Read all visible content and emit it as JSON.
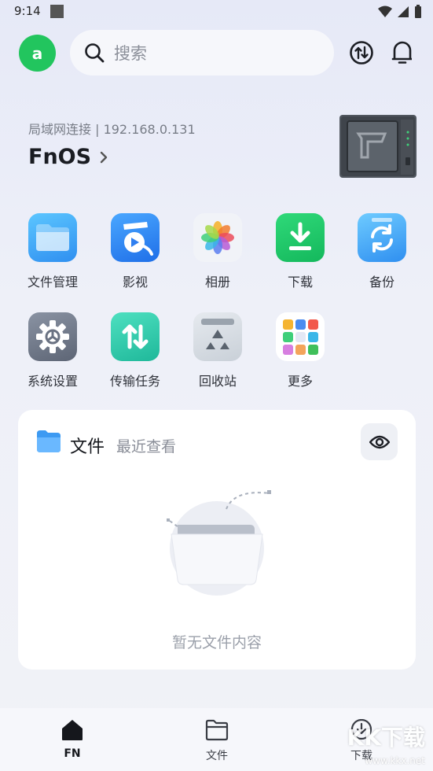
{
  "status_bar": {
    "time": "9:14"
  },
  "search": {
    "placeholder": "搜索"
  },
  "user": {
    "avatar_letter": "a"
  },
  "server": {
    "connection": "局域网连接 | 192.168.0.131",
    "name": "FnOS"
  },
  "apps": [
    {
      "label": "文件管理",
      "icon": "folder-icon"
    },
    {
      "label": "影视",
      "icon": "video-icon"
    },
    {
      "label": "相册",
      "icon": "photos-icon"
    },
    {
      "label": "下载",
      "icon": "download-icon"
    },
    {
      "label": "备份",
      "icon": "backup-icon"
    },
    {
      "label": "系统设置",
      "icon": "gear-icon"
    },
    {
      "label": "传输任务",
      "icon": "transfer-icon"
    },
    {
      "label": "回收站",
      "icon": "recycle-bin-icon"
    },
    {
      "label": "更多",
      "icon": "more-apps-icon"
    }
  ],
  "files_card": {
    "title": "文件",
    "subtitle": "最近查看",
    "empty": "暂无文件内容"
  },
  "nav": [
    {
      "label": "FN",
      "icon": "home-icon",
      "active": true
    },
    {
      "label": "文件",
      "icon": "folder-outline-icon",
      "active": false
    },
    {
      "label": "下载",
      "icon": "download-cloud-icon",
      "active": false
    }
  ],
  "watermark": {
    "text": "KK下载",
    "url": "www.kkx.net"
  },
  "colors": {
    "accent": "#22c55e",
    "primary_text": "#1f2229",
    "muted_text": "#8b8f99"
  }
}
